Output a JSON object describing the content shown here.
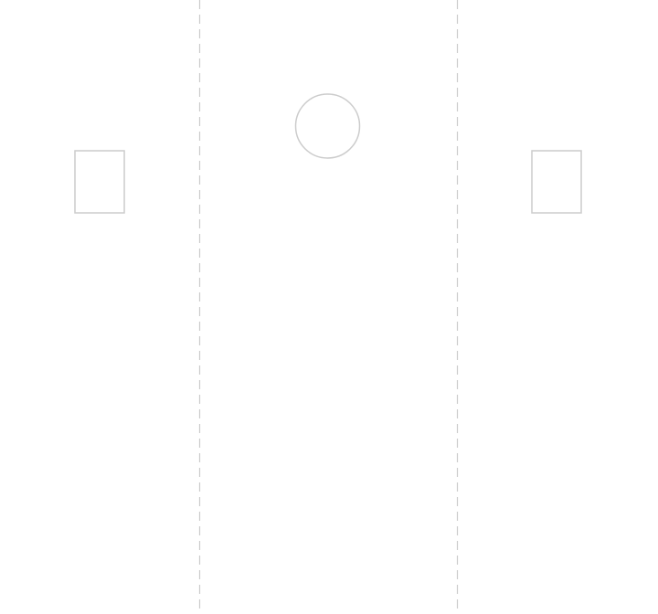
{
  "page": {
    "background": "#ffffff",
    "stroke_color": "#cccccc"
  },
  "lanes": {
    "count": 3,
    "divider_style": "dashed"
  },
  "markers": [
    {
      "id": "left-marker",
      "shape": "rectangle",
      "lane": 1
    },
    {
      "id": "center-marker",
      "shape": "circle",
      "lane": 2
    },
    {
      "id": "right-marker",
      "shape": "rectangle",
      "lane": 3
    }
  ]
}
